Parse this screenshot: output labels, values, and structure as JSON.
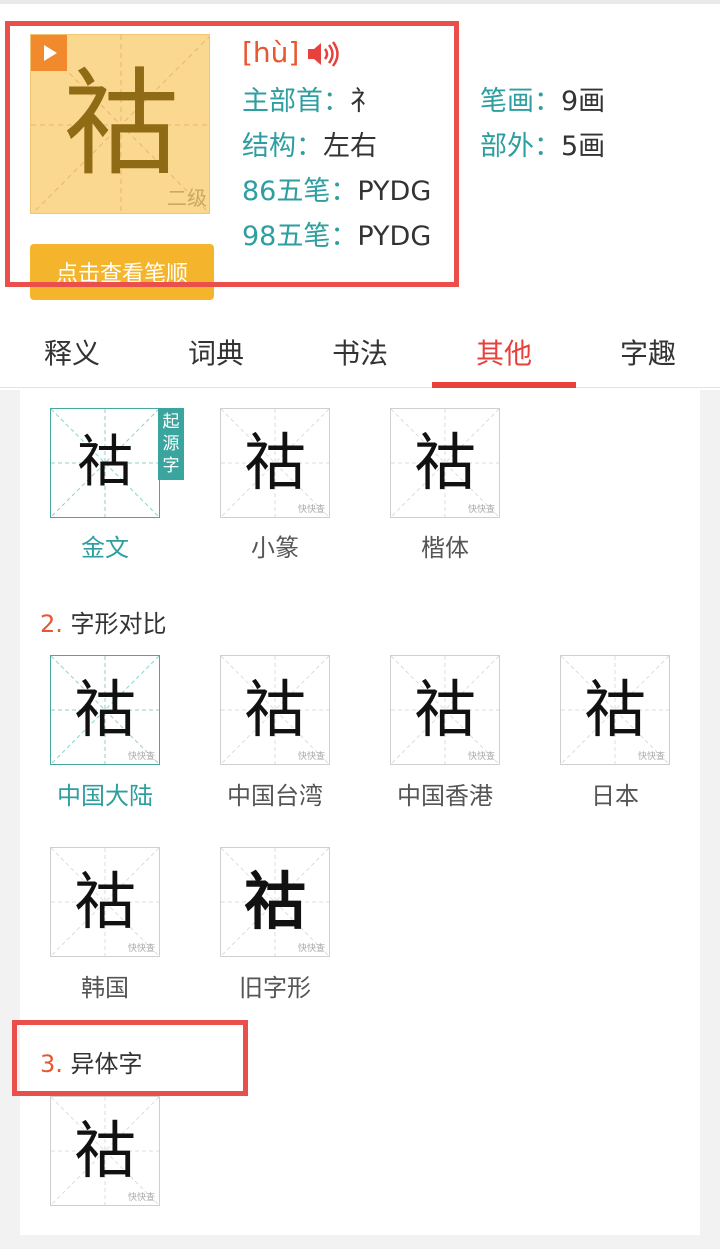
{
  "character": {
    "glyph": "祜",
    "level": "二级",
    "pinyin": "[hù]",
    "stroke_order_button": "点击查看笔顺"
  },
  "info": {
    "radical_label": "主部首：",
    "radical_value": "礻",
    "strokes_label": "笔画：",
    "strokes_value": "9画",
    "structure_label": "结构：",
    "structure_value": "左右",
    "outside_label": "部外：",
    "outside_value": "5画",
    "wubi86_label": "86五笔：",
    "wubi86_value": "PYDG",
    "wubi98_label": "98五笔：",
    "wubi98_value": "PYDG"
  },
  "tabs": [
    "释义",
    "词典",
    "书法",
    "其他",
    "字趣"
  ],
  "active_tab": "其他",
  "evolution": {
    "origin_badge": "起源字",
    "items": [
      {
        "label": "金文",
        "glyph": "祜",
        "selected": true
      },
      {
        "label": "小篆",
        "glyph": "祜",
        "selected": false
      },
      {
        "label": "楷体",
        "glyph": "祜",
        "selected": false
      }
    ]
  },
  "comparison": {
    "number": "2.",
    "title": "字形对比",
    "items": [
      {
        "label": "中国大陆",
        "glyph": "祜",
        "selected": true
      },
      {
        "label": "中国台湾",
        "glyph": "祜",
        "selected": false
      },
      {
        "label": "中国香港",
        "glyph": "祜",
        "selected": false
      },
      {
        "label": "日本",
        "glyph": "祜",
        "selected": false
      },
      {
        "label": "韩国",
        "glyph": "祜",
        "selected": false
      },
      {
        "label": "旧字形",
        "glyph": "祜",
        "selected": false
      }
    ]
  },
  "variants": {
    "number": "3.",
    "title": "异体字",
    "items": [
      {
        "glyph": "祜"
      }
    ]
  },
  "watermark": "快快查",
  "colors": {
    "accent_red": "#e8413d",
    "teal": "#2e9ea0",
    "card_bg": "#fbd890",
    "button": "#f4b42b",
    "highlight": "#ea4f4b"
  }
}
